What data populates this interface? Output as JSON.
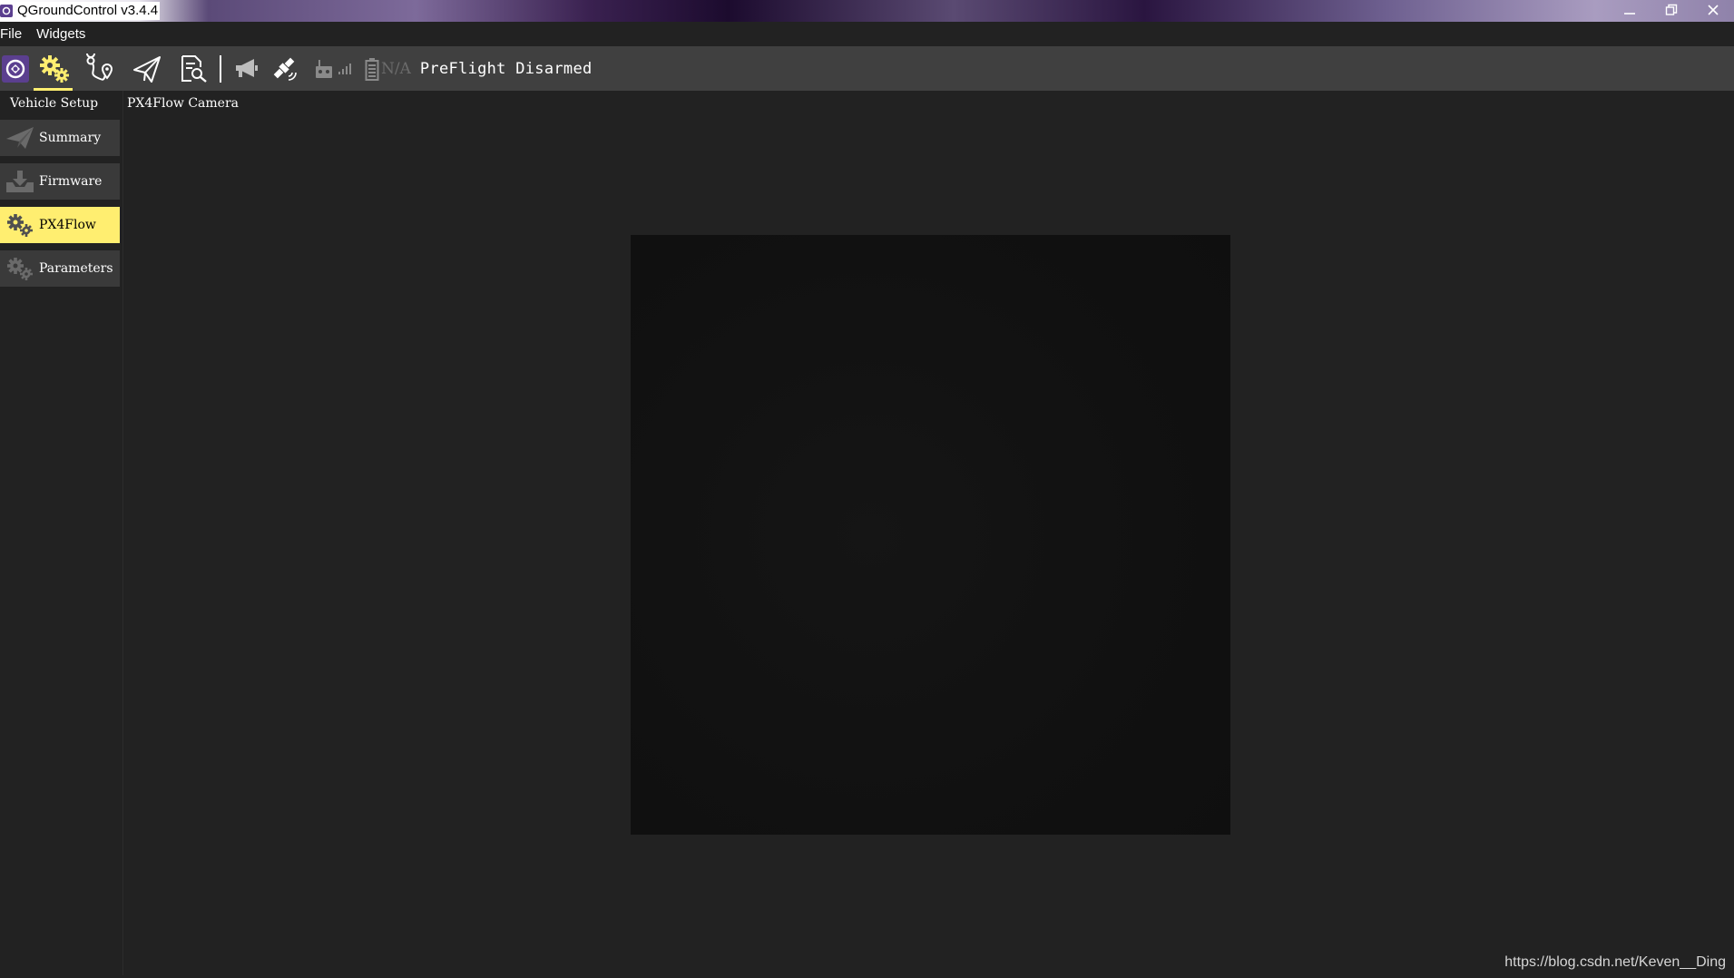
{
  "window": {
    "title": "QGroundControl v3.4.4",
    "minimize_label": "—",
    "maximize_label": "❐",
    "close_label": "✕"
  },
  "menubar": {
    "items": [
      {
        "label": "File"
      },
      {
        "label": "Widgets"
      }
    ]
  },
  "toolbar": {
    "tools": [
      {
        "name": "qgc-logo-icon"
      },
      {
        "name": "vehicle-setup-icon",
        "active": true
      },
      {
        "name": "plan-view-icon"
      },
      {
        "name": "fly-view-icon"
      },
      {
        "name": "analyze-view-icon"
      }
    ],
    "battery_value": "N/A",
    "status": "PreFlight Disarmed",
    "active_color": "#ffee70"
  },
  "sidebar": {
    "title": "Vehicle Setup",
    "items": [
      {
        "label": "Summary",
        "icon": "paper-plane-icon"
      },
      {
        "label": "Firmware",
        "icon": "firmware-download-icon"
      },
      {
        "label": "PX4Flow",
        "icon": "gears-icon",
        "selected": true
      },
      {
        "label": "Parameters",
        "icon": "gears-icon"
      }
    ]
  },
  "main": {
    "title": "PX4Flow Camera"
  },
  "watermark": "https://blog.csdn.net/Keven__Ding"
}
